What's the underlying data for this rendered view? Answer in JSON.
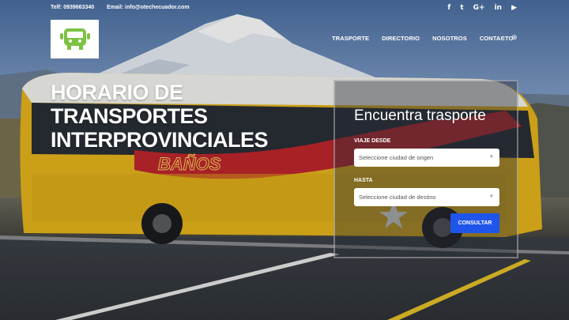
{
  "topbar": {
    "phone": "Telf: 0939663340",
    "email": "Email: info@otechecuador.com",
    "social": [
      {
        "icon": "facebook-icon",
        "glyph": "f"
      },
      {
        "icon": "twitter-icon",
        "glyph": "t"
      },
      {
        "icon": "google-plus-icon",
        "glyph": "G+"
      },
      {
        "icon": "linkedin-icon",
        "glyph": "in"
      },
      {
        "icon": "youtube-icon",
        "glyph": "▶"
      }
    ]
  },
  "nav": {
    "items": [
      "TRASPORTE",
      "DIRECTORIO",
      "NOSOTROS",
      "CONTACTO"
    ],
    "search_glyph": "⌕",
    "language_glyph": "⊕"
  },
  "hero": {
    "lines": [
      "HORARIO DE",
      "TRANSPORTES",
      "INTERPROVINCIALES"
    ]
  },
  "search": {
    "title": "Encuentra trasporte",
    "from_label": "VIAJE DESDE",
    "from_placeholder": "Seleccione ciudad de origen",
    "to_label": "HASTA",
    "to_placeholder": "Seleccione ciudad de destino",
    "button": "CONSULTAR"
  },
  "bus": {
    "brand_text": "BAÑOS"
  },
  "colors": {
    "accent_button": "#1f55ea",
    "bus_yellow": "#e7b51c",
    "logo_green": "#7cc242"
  }
}
